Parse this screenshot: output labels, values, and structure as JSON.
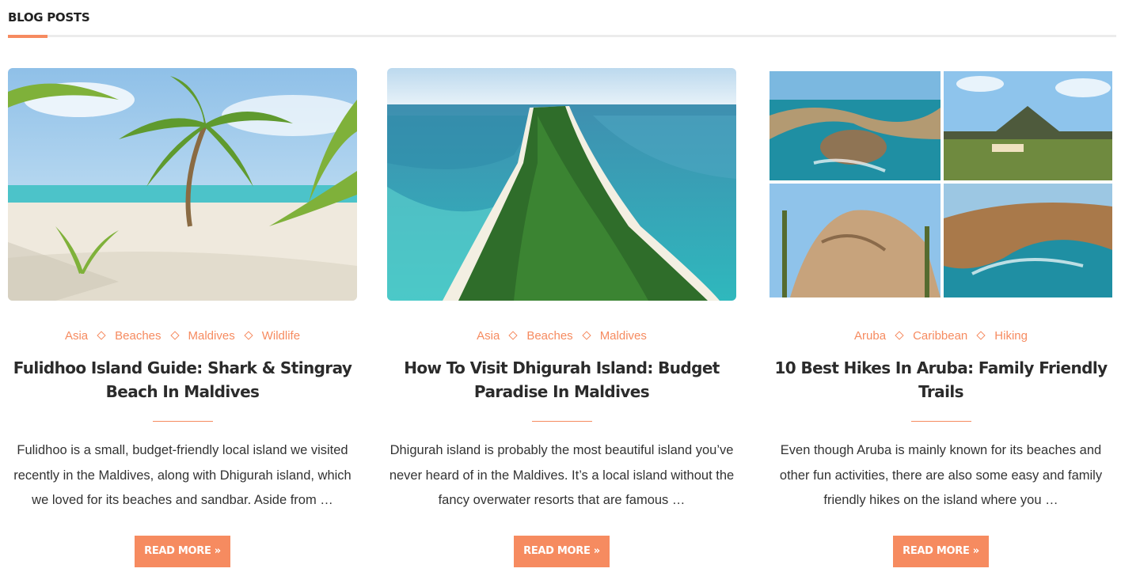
{
  "section": {
    "title": "BLOG POSTS"
  },
  "posts": [
    {
      "image_alt": "Beach with palm trees",
      "categories": [
        "Asia",
        "Beaches",
        "Maldives",
        "Wildlife"
      ],
      "title": "Fulidhoo Island Guide: Shark & Stingray Beach In Maldives",
      "excerpt": "Fulidhoo is a small, budget-friendly local island we visited recently in the Maldives, along with Dhigurah island, which we loved for its beaches and sandbar. Aside from …",
      "read_more": "READ MORE »"
    },
    {
      "image_alt": "Aerial view of a long forested island",
      "categories": [
        "Asia",
        "Beaches",
        "Maldives"
      ],
      "title": "How To Visit Dhigurah Island: Budget Paradise In Maldives",
      "excerpt": "Dhigurah island is probably the most beautiful island you’ve never heard of in the Maldives. It’s a local island without the fancy overwater resorts that are famous …",
      "read_more": "READ MORE »"
    },
    {
      "image_alt": "Collage of Aruba landscapes",
      "categories": [
        "Aruba",
        "Caribbean",
        "Hiking"
      ],
      "title": "10 Best Hikes In Aruba: Family Friendly Trails",
      "excerpt": "Even though Aruba is mainly known for its beaches and other fun activities, there are also some easy and family friendly hikes on the island where you …",
      "read_more": "READ MORE »"
    }
  ],
  "colors": {
    "accent": "#f68b60",
    "title": "#2b2b2b",
    "text": "#333333"
  },
  "icons": {
    "read_more": "double-chevron-right-icon",
    "category_separator": "diamond-icon"
  }
}
